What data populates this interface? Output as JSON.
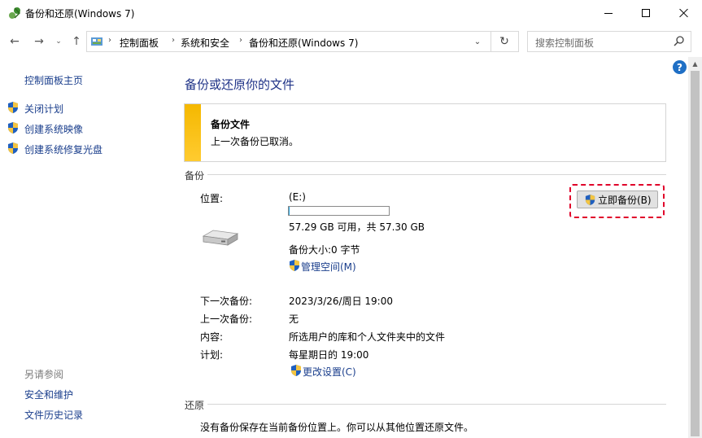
{
  "window": {
    "title": "备份和还原(Windows 7)"
  },
  "address": {
    "crumbs": [
      "控制面板",
      "系统和安全",
      "备份和还原(Windows 7)"
    ],
    "search_placeholder": "搜索控制面板"
  },
  "sidebar": {
    "home": "控制面板主页",
    "tasks": [
      "关闭计划",
      "创建系统映像",
      "创建系统修复光盘"
    ],
    "see_also_title": "另请参阅",
    "see_also": [
      "安全和维护",
      "文件历史记录"
    ]
  },
  "main": {
    "title": "备份或还原你的文件",
    "notice": {
      "heading": "备份文件",
      "message": "上一次备份已取消。"
    },
    "backup_section": "备份",
    "location_label": "位置:",
    "location_value": "(E:)",
    "drive_usage_fraction": 0.01,
    "space_text": "57.29 GB 可用，共 57.30 GB",
    "backup_size": "备份大小:0 字节",
    "manage_space": "管理空间(M)",
    "backup_now": "立即备份(B)",
    "details": [
      {
        "label": "下一次备份:",
        "value": "2023/3/26/周日 19:00"
      },
      {
        "label": "上一次备份:",
        "value": "无"
      },
      {
        "label": "内容:",
        "value": "所选用户的库和个人文件夹中的文件"
      },
      {
        "label": "计划:",
        "value": "每星期日的 19:00"
      }
    ],
    "change_settings": "更改设置(C)",
    "restore_section": "还原",
    "restore_text": "没有备份保存在当前备份位置上。你可以从其他位置还原文件。"
  },
  "colors": {
    "link": "#1a3e8c",
    "title": "#1e3287",
    "notice_bar": "#f5b800",
    "highlight": "#e0002a"
  }
}
